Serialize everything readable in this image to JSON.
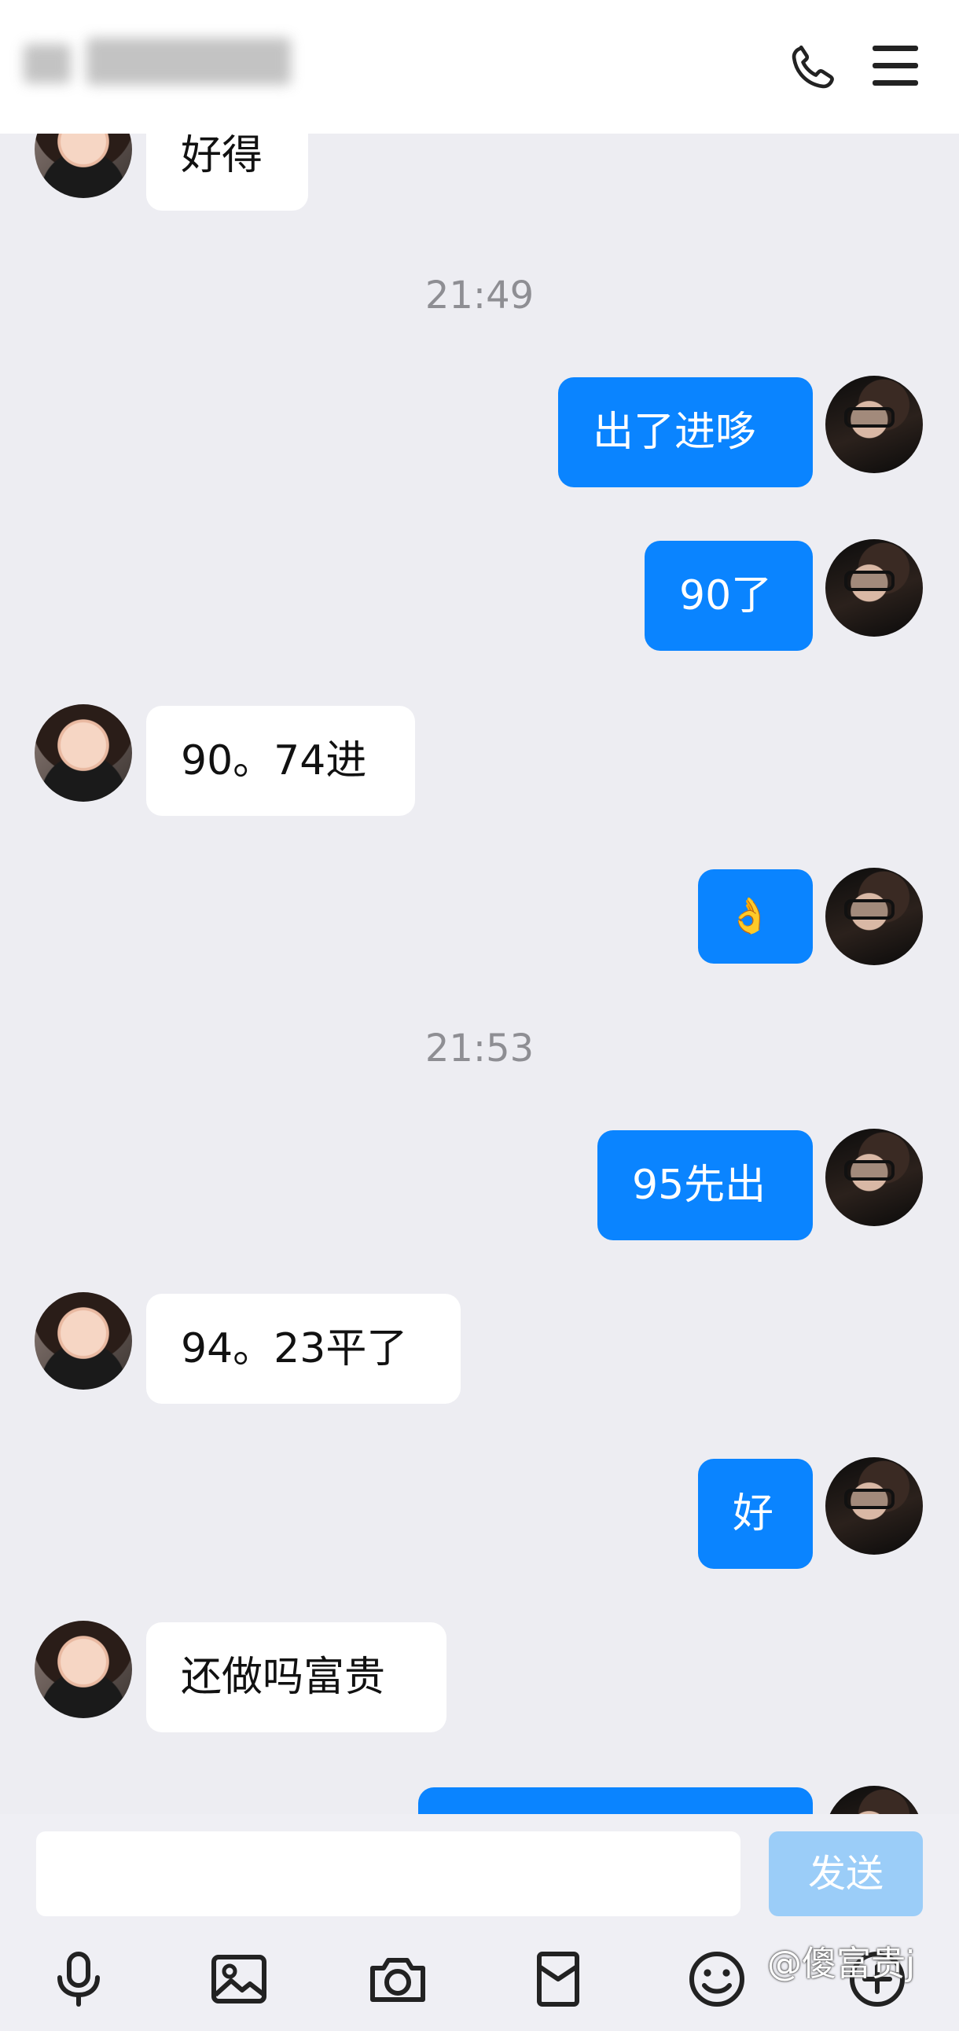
{
  "header": {
    "contact_name": "",
    "call_icon": "phone-icon",
    "menu_icon": "menu-icon"
  },
  "messages": [
    {
      "side": "in",
      "text": "好得"
    },
    {
      "type": "time",
      "text": "21:49"
    },
    {
      "side": "out",
      "text": "出了进哆"
    },
    {
      "side": "out",
      "text": "90了"
    },
    {
      "side": "in",
      "text": "90。74进"
    },
    {
      "side": "out",
      "text": "👌"
    },
    {
      "type": "time",
      "text": "21:53"
    },
    {
      "side": "out",
      "text": "95先出"
    },
    {
      "side": "in",
      "text": "94。23平了"
    },
    {
      "side": "out",
      "text": "好"
    },
    {
      "side": "in",
      "text": "还做吗富贵"
    }
  ],
  "composer": {
    "input_value": "",
    "send_label": "发送"
  },
  "toolbar": {
    "icons": [
      "microphone-icon",
      "image-icon",
      "camera-icon",
      "red-packet-icon",
      "emoji-icon",
      "plus-icon"
    ]
  },
  "watermark": "@傻富贵j",
  "colors": {
    "outgoing_bubble": "#0a84ff",
    "incoming_bubble": "#ffffff",
    "background": "#ededf2",
    "send_button": "#9bcdf8"
  }
}
